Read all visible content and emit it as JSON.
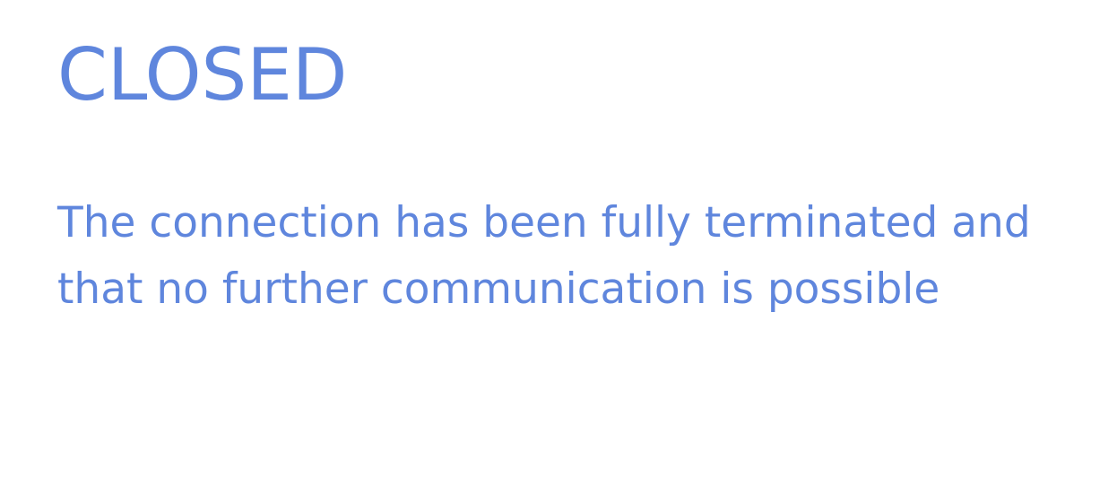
{
  "slide": {
    "title": "CLOSED",
    "description": "The connection has been fully terminated and that no further communication is possible"
  },
  "colors": {
    "text": "#5f86dd",
    "background": "#ffffff"
  }
}
